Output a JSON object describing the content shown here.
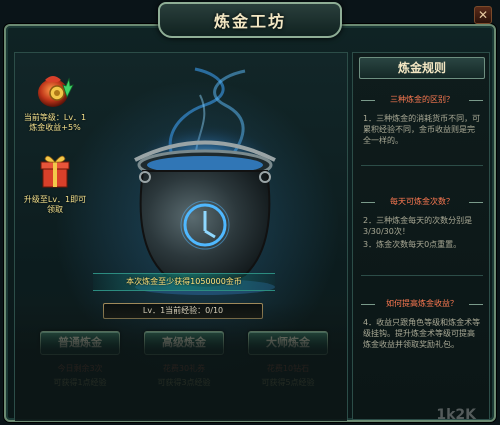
{
  "window": {
    "title": "炼金工坊",
    "close_label": "✕"
  },
  "side_items": [
    {
      "id": "level",
      "icon": "gold-bag-icon",
      "lines": [
        "当前等级：Lv．1",
        "炼金收益+5%"
      ]
    },
    {
      "id": "upgrade",
      "icon": "gift-box-icon",
      "lines": [
        "升级至Lv．1即可",
        "领取"
      ]
    }
  ],
  "reward_banner": "本次炼金至少获得1050000金币",
  "exp": {
    "text": "Lv．1当前经验：0/10",
    "current": 0,
    "max": 10
  },
  "crafts": [
    {
      "label": "普通炼金",
      "cost": "今日剩余3次",
      "gain": "可获得1点经验"
    },
    {
      "label": "高级炼金",
      "cost": "花费30礼券",
      "gain": "可获得3点经验"
    },
    {
      "label": "大师炼金",
      "cost": "花费10钻石",
      "gain": "可获得5点经验"
    }
  ],
  "rules": {
    "title": "炼金规则",
    "sections": [
      {
        "q": "三种炼金的区别？",
        "a": [
          "1．三种炼金的消耗货币不同，可累积经验不同，金币收益则是完全一样的。"
        ]
      },
      {
        "q": "每天可炼金次数？",
        "a": [
          "2．三种炼金每天的次数分别是3/30/30次！",
          "3．炼金次数每天0点重置。"
        ]
      },
      {
        "q": "如何提高炼金收益？",
        "a": [
          "4．收益只跟角色等级和炼金术等级挂钩。提升炼金术等级可提高炼金收益并领取奖励礼包。"
        ]
      }
    ]
  },
  "watermark": "1k2K",
  "colors": {
    "accent_green": "#1f5043",
    "cost_red": "#ff6a4a",
    "title_gold": "#f3e7c3",
    "glow_blue": "#4aa8ff"
  }
}
